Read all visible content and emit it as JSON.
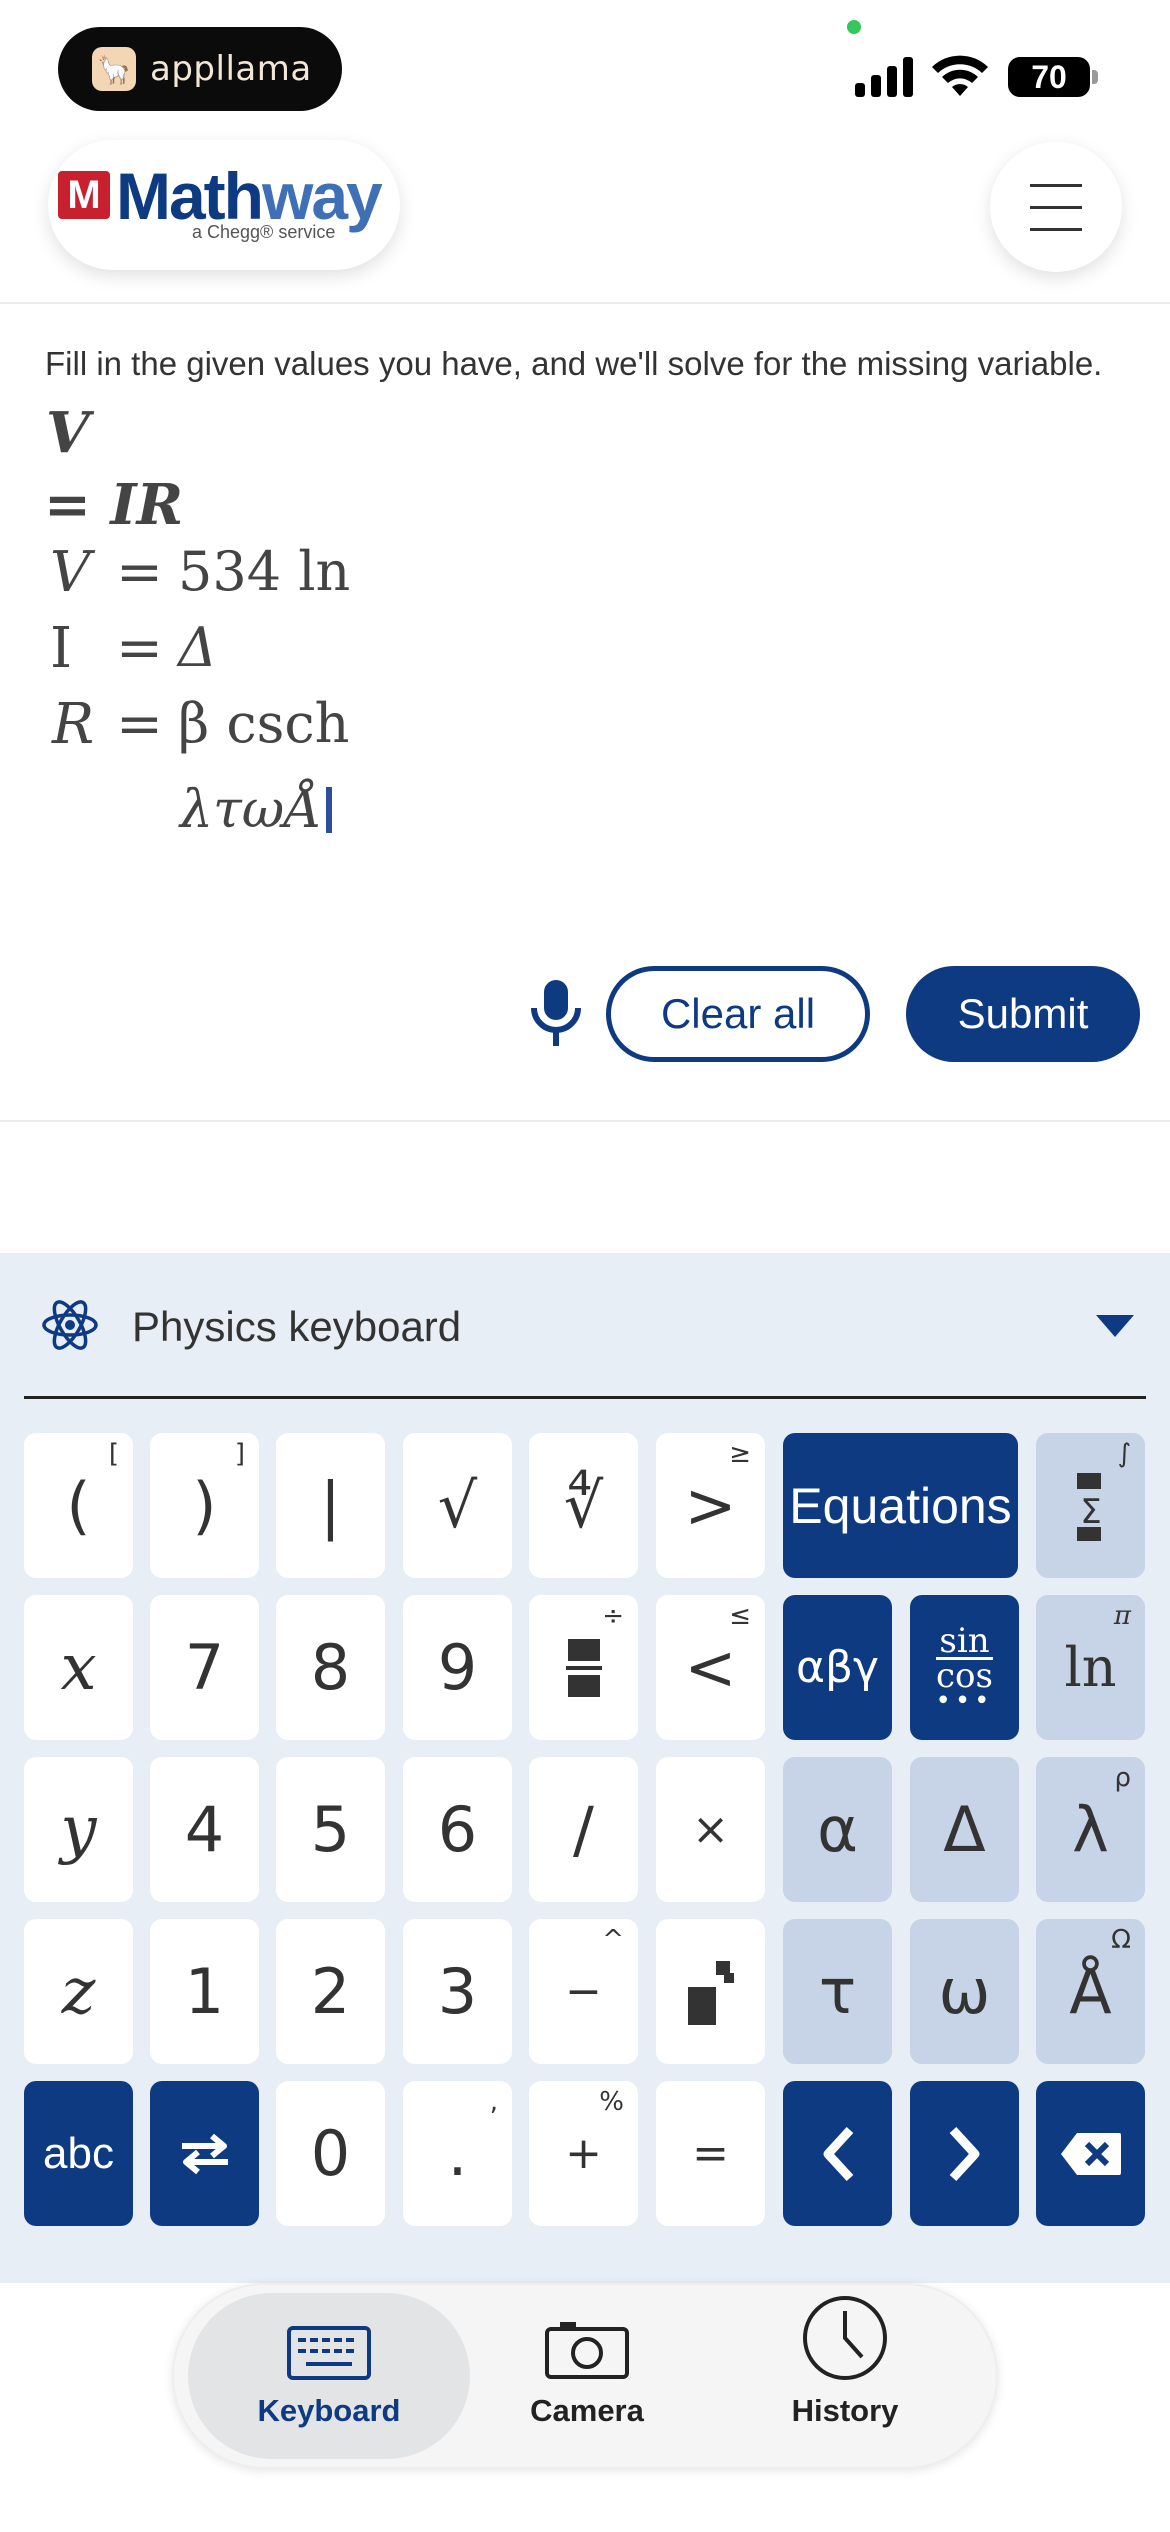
{
  "status_bar": {
    "app_pill": "appllama",
    "battery": "70"
  },
  "header": {
    "logo_brand_a": "Math",
    "logo_brand_b": "way",
    "logo_mark": "M",
    "logo_sub": "a Chegg® service"
  },
  "solver": {
    "instructions": "Fill in the given values you have, and we'll solve for the missing variable.",
    "formula_lhs": "V",
    "formula_rhs": "= IR",
    "rows": [
      {
        "label": "V",
        "eq": "=",
        "value": "534 ln"
      },
      {
        "label": "I",
        "eq": "=",
        "value": "Δ"
      },
      {
        "label": "R",
        "eq": "=",
        "value": "β csch"
      }
    ],
    "continuation": "λτωÅ",
    "clear_label": "Clear all",
    "submit_label": "Submit"
  },
  "keyboard": {
    "title": "Physics keyboard",
    "keys": {
      "lparen": "(",
      "lparen_sup": "[",
      "rparen": ")",
      "rparen_sup": "]",
      "abs": "|",
      "sqrt": "√",
      "nthroot": "∜",
      "gt": ">",
      "gt_sup": "≥",
      "equations": "Equations",
      "sum_sup": "∫",
      "x": "x",
      "seven": "7",
      "eight": "8",
      "nine": "9",
      "frac_sup": "÷",
      "lt": "<",
      "lt_sup": "≤",
      "greek": "αβγ",
      "trig_top": "sin",
      "trig_bot": "cos",
      "ln": "ln",
      "ln_sup": "π",
      "y": "y",
      "four": "4",
      "five": "5",
      "six": "6",
      "slash": "/",
      "times": "×",
      "alpha": "α",
      "delta": "Δ",
      "lambda": "λ",
      "lambda_sup": "ρ",
      "z": "z",
      "one": "1",
      "two": "2",
      "three": "3",
      "minus": "−",
      "minus_sup": "^",
      "tau": "τ",
      "omega": "ω",
      "angstrom": "Å",
      "angstrom_sup": "Ω",
      "abc": "abc",
      "zero": "0",
      "dot": ".",
      "dot_sup": ",",
      "plus": "+",
      "plus_sup": "%",
      "equals": "="
    }
  },
  "nav": {
    "keyboard": "Keyboard",
    "camera": "Camera",
    "history": "History"
  },
  "colors": {
    "brand": "#0e3a82",
    "accent_light": "#c7d3e6",
    "keyboard_bg": "#e7eef6",
    "logo_red": "#c8202e"
  }
}
